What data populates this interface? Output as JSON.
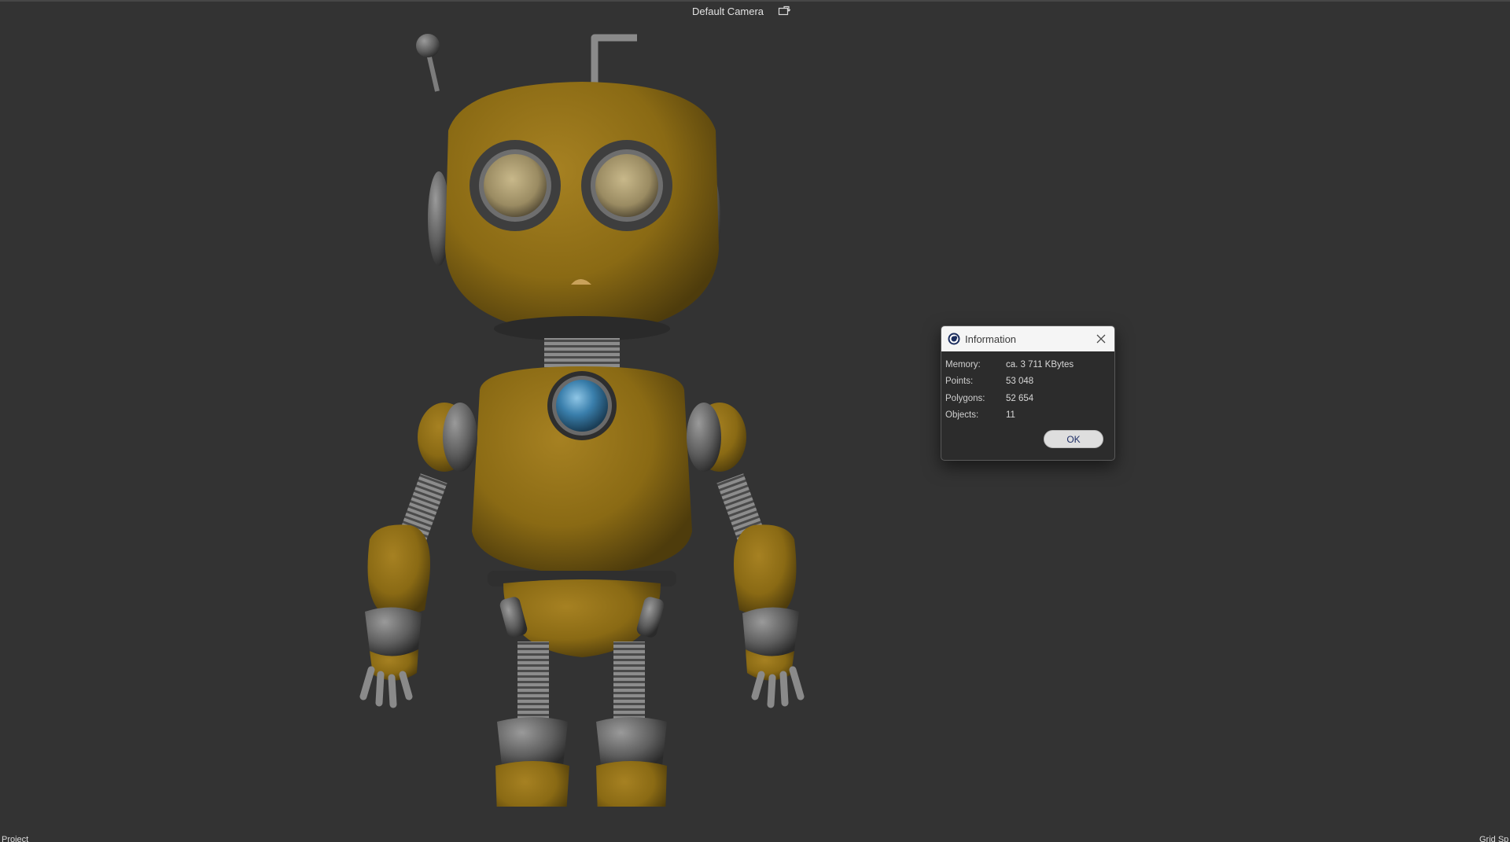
{
  "viewport": {
    "camera_label": "Default Camera",
    "camera_icon": "camera-switch-icon"
  },
  "scene": {
    "object": "robot-character",
    "body_color": "#9a7416",
    "metal_color": "#6b6b6b",
    "chest_light_color": "#3f86b4"
  },
  "info_dialog": {
    "title": "Information",
    "app_icon": "cinema4d-logo-icon",
    "close_icon": "close-icon",
    "rows": [
      {
        "label": "Memory:",
        "value": "ca. 3 711 KBytes"
      },
      {
        "label": "Points:",
        "value": "53 048"
      },
      {
        "label": "Polygons:",
        "value": "52 654"
      },
      {
        "label": "Objects:",
        "value": "11"
      }
    ],
    "ok_label": "OK"
  },
  "footer": {
    "left_label": "Project",
    "right_label": "Grid Sp"
  }
}
